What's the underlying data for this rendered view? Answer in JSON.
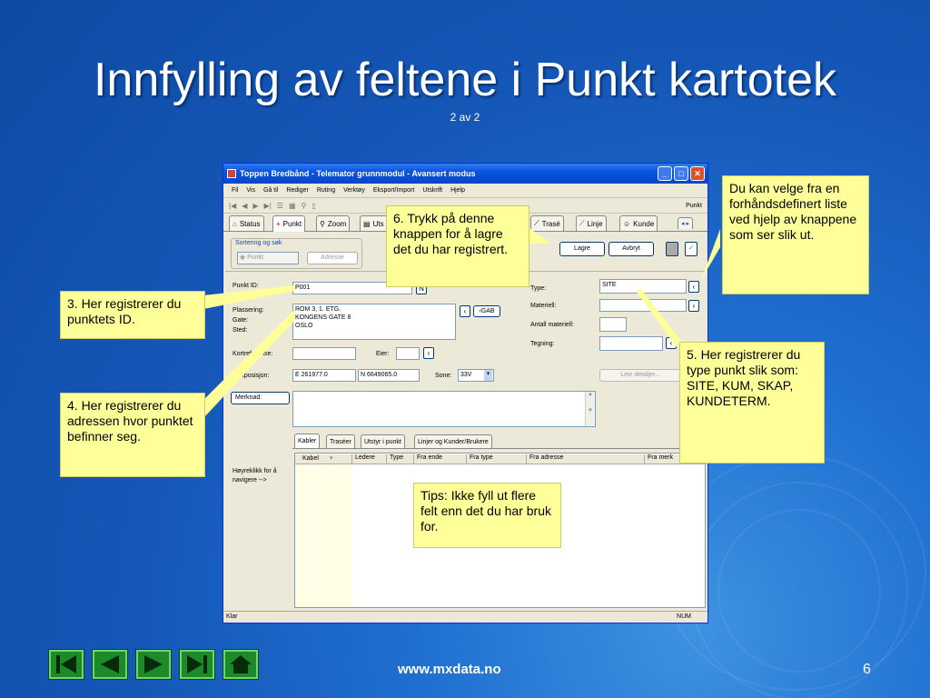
{
  "slide": {
    "title": "Innfylling av feltene i Punkt kartotek",
    "subtitle": "2 av 2",
    "footer_url": "www.mxdata.no",
    "page_number": "6"
  },
  "window": {
    "title": "Toppen Bredbånd - Telemator grunnmodul - Avansert modus",
    "menu": [
      "Fil",
      "Vis",
      "Gå til",
      "Rediger",
      "Ruting",
      "Verktøy",
      "Eksport/Import",
      "Utskrift",
      "Hjelp"
    ],
    "toolbar_right_label": "Punkt",
    "nav_tabs": [
      "Status",
      "Punkt",
      "Zoom",
      "Uts",
      "Trasé",
      "Linje",
      "Kunde"
    ],
    "status_left": "Klar",
    "status_right": "NUM"
  },
  "form": {
    "search_group_label": "Sortering og søk",
    "search_option": "Punkt",
    "search_address_button": "Adresse",
    "save_button": "Lagre",
    "cancel_button": "Avbryt",
    "punkt_id_label": "Punkt ID:",
    "punkt_id_value": "P001",
    "n_button": "N",
    "location_labels": [
      "Plassering:",
      "Gate:",
      "Sted:"
    ],
    "location_values": [
      "ROM 3, 1. ETG.",
      "KONGENS GATE 8",
      "OSLO"
    ],
    "gab_button": "GAB",
    "reference_label": "Kortreferanse:",
    "owner_label": "Eier:",
    "coords_label": "Kartposisjon:",
    "coord_e": "E 261977.0",
    "coord_n": "N 6649065.0",
    "zone_label": "Sone:",
    "zone_value": "33V",
    "type_label": "Type:",
    "type_value": "SITE",
    "material_label": "Materiell:",
    "material_count_label": "Antall materiell:",
    "drawing_label": "Tegning:",
    "lease_button": "Leie detaljer...",
    "note_button": "Merknad:",
    "sub_tabs": [
      "Kabler",
      "Traséer",
      "Utstyr i punkt",
      "Linjer og Kunder/Brukere"
    ],
    "grid_columns": [
      "Kabel",
      "Ledere",
      "Type",
      "Fra ende",
      "Fra type",
      "Fra adresse",
      "Fra merk"
    ],
    "rightclick_hint": "Høyreklikk for å navigere -->"
  },
  "callouts": {
    "id_hint": "3. Her registrerer du punktets ID.",
    "address_hint": "4. Her registrerer du adressen hvor punktet befinner seg.",
    "type_hint": "5. Her registrerer du type punkt slik som:\nSITE, KUM, SKAP, KUNDETERM.",
    "save_hint": "6. Trykk på denne knappen for å lagre det du har registrert.",
    "list_hint": "Du kan velge fra en forhåndsdefinert liste ved hjelp av knappene som ser slik ut.",
    "tips": "Tips: Ikke fyll ut flere felt enn det du har bruk for."
  },
  "icons": {
    "nav": [
      "first-icon",
      "prev-icon",
      "next-icon",
      "last-icon",
      "home-icon"
    ]
  },
  "colors": {
    "callout_bg": "#ffff99",
    "slide_bg": "#1557b7",
    "nav_green": "#1d8a2a"
  }
}
